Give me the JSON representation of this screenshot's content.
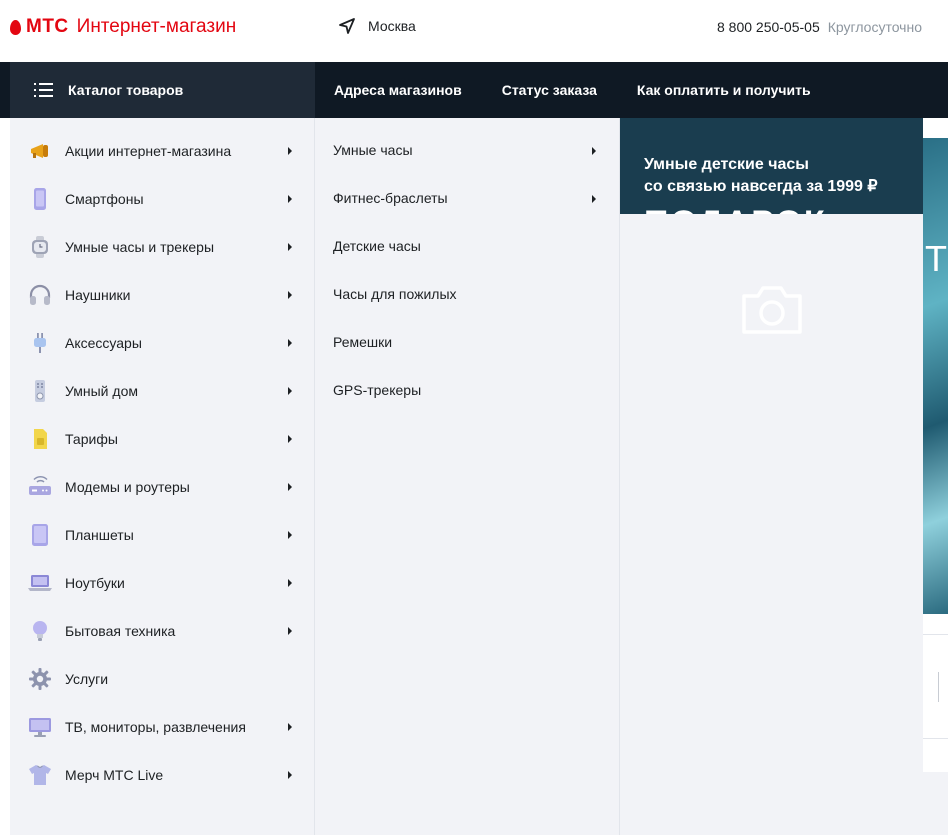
{
  "header": {
    "brand": "МТС",
    "store_name": "Интернет-магазин",
    "city": "Москва",
    "phone": "8 800 250-05-05",
    "phone_hours": "Круглосуточно"
  },
  "nav": {
    "catalog_label": "Каталог товаров",
    "links": [
      "Адреса магазинов",
      "Статус заказа",
      "Как оплатить и получить"
    ]
  },
  "catalog": {
    "items": [
      {
        "label": "Акции интернет-магазина",
        "icon": "megaphone-icon",
        "has_sub": true
      },
      {
        "label": "Смартфоны",
        "icon": "smartphone-icon",
        "has_sub": true
      },
      {
        "label": "Умные часы и трекеры",
        "icon": "smartwatch-icon",
        "has_sub": true
      },
      {
        "label": "Наушники",
        "icon": "headphones-icon",
        "has_sub": true
      },
      {
        "label": "Аксессуары",
        "icon": "charger-icon",
        "has_sub": true
      },
      {
        "label": "Умный дом",
        "icon": "smart-home-icon",
        "has_sub": true
      },
      {
        "label": "Тарифы",
        "icon": "sim-card-icon",
        "has_sub": true
      },
      {
        "label": "Модемы и роутеры",
        "icon": "router-icon",
        "has_sub": true
      },
      {
        "label": "Планшеты",
        "icon": "tablet-icon",
        "has_sub": true
      },
      {
        "label": "Ноутбуки",
        "icon": "laptop-icon",
        "has_sub": true
      },
      {
        "label": "Бытовая техника",
        "icon": "lightbulb-icon",
        "has_sub": true
      },
      {
        "label": "Услуги",
        "icon": "gear-icon",
        "has_sub": false
      },
      {
        "label": "ТВ, мониторы, развлечения",
        "icon": "monitor-icon",
        "has_sub": true
      },
      {
        "label": "Мерч МТС Live",
        "icon": "tshirt-icon",
        "has_sub": true
      }
    ]
  },
  "submenu": {
    "items": [
      {
        "label": "Умные часы",
        "has_sub": true
      },
      {
        "label": "Фитнес-браслеты",
        "has_sub": true
      },
      {
        "label": "Детские часы",
        "has_sub": false
      },
      {
        "label": "Часы для пожилых",
        "has_sub": false
      },
      {
        "label": "Ремешки",
        "has_sub": false
      },
      {
        "label": "GPS-трекеры",
        "has_sub": false
      }
    ]
  },
  "promo": {
    "line1": "Умные детские часы",
    "line2": "со связью навсегда за 1999 ₽",
    "big_text": "ПОДАРОК"
  },
  "background": {
    "banner_letter": "Т"
  },
  "colors": {
    "brand_red": "#e30611",
    "nav_dark": "#0f1924",
    "catalog_btn": "#1f2a37",
    "panel_bg": "#f2f3f7"
  }
}
